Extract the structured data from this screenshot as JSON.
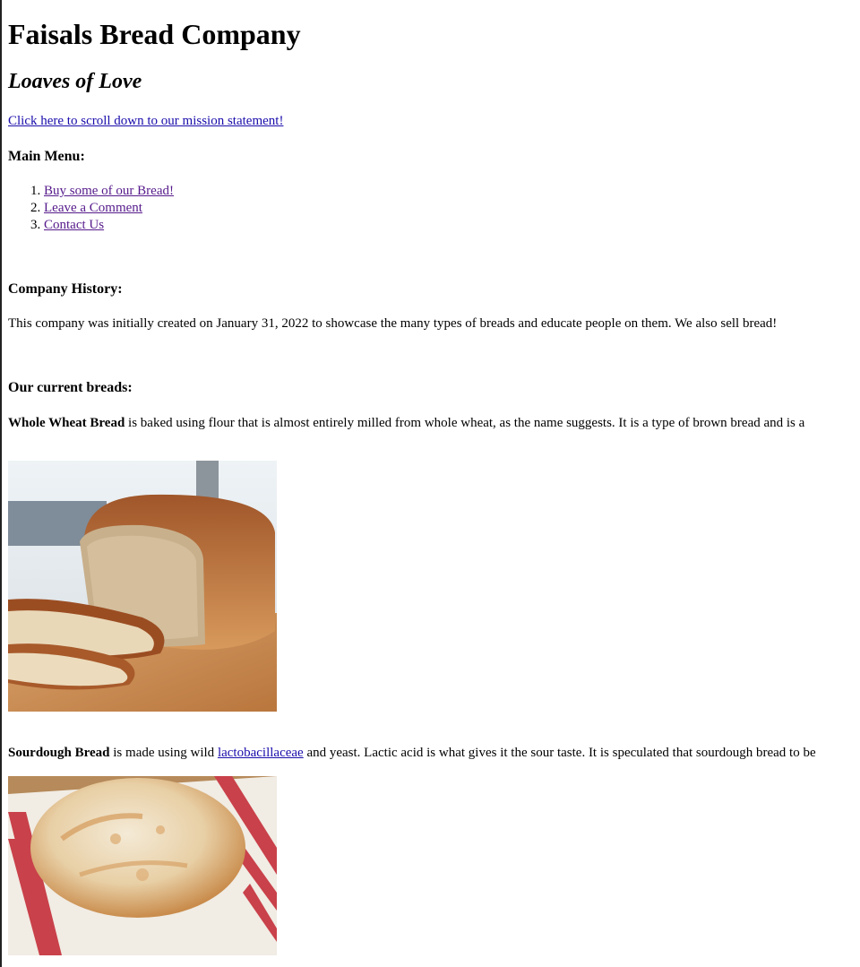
{
  "header": {
    "title": "Faisals Bread Company",
    "tagline": "Loaves of Love",
    "mission_link": "Click here to scroll down to our mission statement!"
  },
  "menu": {
    "heading": "Main Menu:",
    "items": [
      {
        "label": "Buy some of our Bread!"
      },
      {
        "label": "Leave a Comment"
      },
      {
        "label": "Contact Us"
      }
    ]
  },
  "history": {
    "heading": "Company History:",
    "text": "This company was initially created on January 31, 2022 to showcase the many types of breads and educate people on them. We also sell bread!"
  },
  "breads": {
    "heading": "Our current breads:",
    "items": [
      {
        "name": "Whole Wheat Bread",
        "description_before": " is baked using flour that is almost entirely milled from whole wheat, as the name suggests. It is a type of brown bread and is a",
        "link": "",
        "description_after": ""
      },
      {
        "name": "Sourdough Bread",
        "description_before": " is made using wild ",
        "link": "lactobacillaceae",
        "description_after": " and yeast. Lactic acid is what gives it the sour taste. It is speculated that sourdough bread to be"
      }
    ]
  },
  "colors": {
    "link": "#1a0dab",
    "visited_link": "#551a8b",
    "text": "#000000",
    "background": "#ffffff"
  }
}
